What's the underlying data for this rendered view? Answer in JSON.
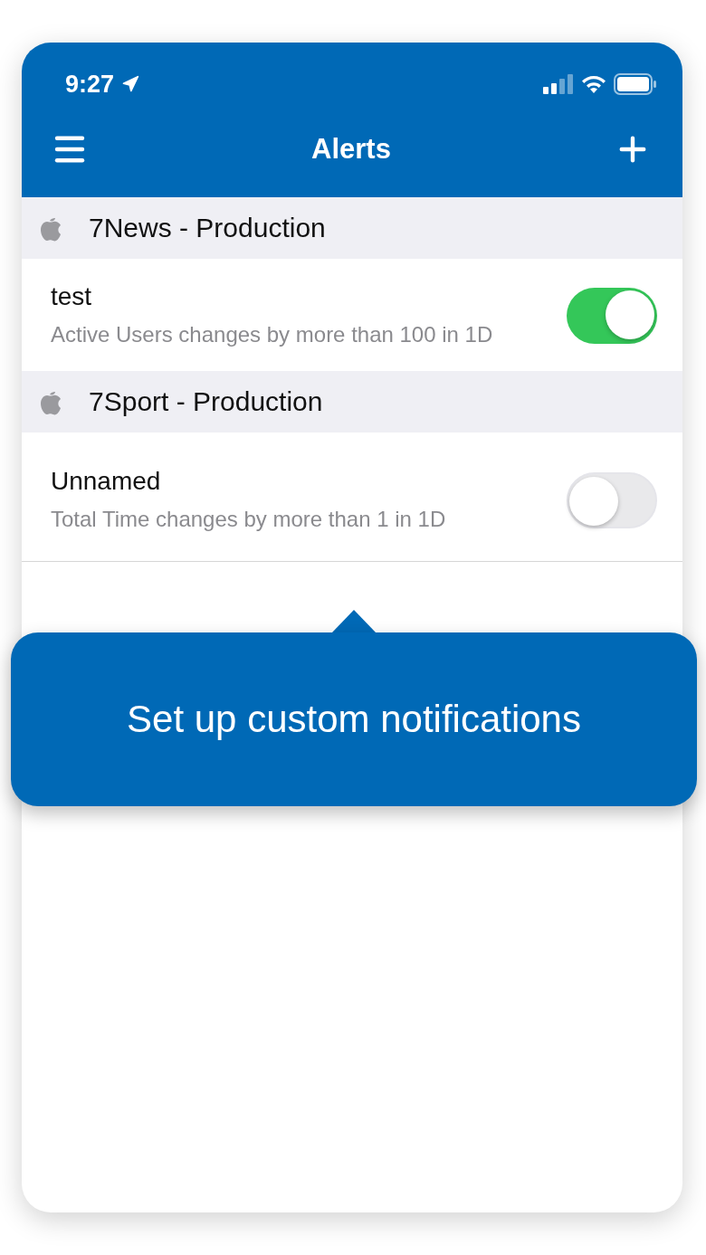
{
  "status_bar": {
    "time": "9:27"
  },
  "nav": {
    "title": "Alerts"
  },
  "sections": [
    {
      "title": "7News - Production",
      "alerts": [
        {
          "name": "test",
          "description": "Active Users changes by more than 100 in 1D",
          "on": true
        }
      ]
    },
    {
      "title": "7Sport - Production",
      "alerts": [
        {
          "name": "Unnamed",
          "description": "Total Time changes by more than 1 in 1D",
          "on": false
        }
      ]
    }
  ],
  "callout": {
    "text": "Set up custom notifications"
  }
}
